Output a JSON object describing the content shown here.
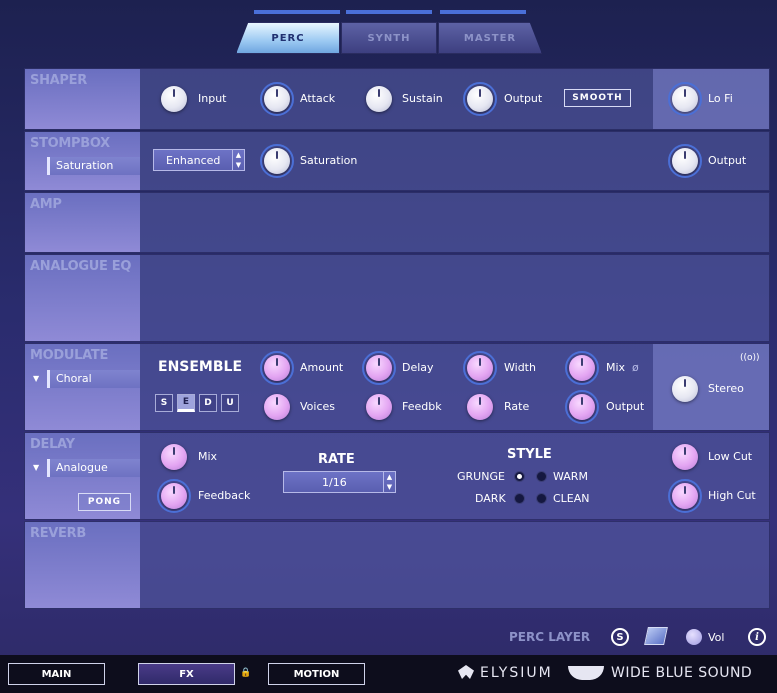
{
  "tabs": [
    {
      "label": "PERC",
      "active": true
    },
    {
      "label": "SYNTH",
      "active": false
    },
    {
      "label": "MASTER",
      "active": false
    }
  ],
  "shaper": {
    "title": "SHAPER",
    "input_label": "Input",
    "attack_label": "Attack",
    "sustain_label": "Sustain",
    "output_label": "Output",
    "smooth_label": "SMOOTH",
    "lofi_label": "Lo Fi"
  },
  "stompbox": {
    "title": "STOMPBOX",
    "type_value": "Saturation",
    "mode_value": "Enhanced",
    "saturation_label": "Saturation",
    "output_label": "Output"
  },
  "amp": {
    "title": "AMP"
  },
  "analogue_eq": {
    "title": "ANALOGUE EQ"
  },
  "modulate": {
    "title": "MODULATE",
    "type_value": "Choral",
    "section_title": "ENSEMBLE",
    "modes": [
      "S",
      "E",
      "D",
      "U"
    ],
    "active_mode": "E",
    "amount_label": "Amount",
    "delay_label": "Delay",
    "width_label": "Width",
    "mix_label": "Mix",
    "phase_symbol": "ø",
    "voices_label": "Voices",
    "feedbk_label": "Feedbk",
    "rate_label": "Rate",
    "output_label": "Output",
    "stereo_icon": "((o))",
    "stereo_label": "Stereo"
  },
  "delay": {
    "title": "DELAY",
    "type_value": "Analogue",
    "pong_label": "PONG",
    "mix_label": "Mix",
    "feedback_label": "Feedback",
    "rate_title": "RATE",
    "rate_value": "1/16",
    "style_title": "STYLE",
    "grunge_label": "GRUNGE",
    "warm_label": "WARM",
    "dark_label": "DARK",
    "clean_label": "CLEAN",
    "lowcut_label": "Low Cut",
    "highcut_label": "High Cut"
  },
  "reverb": {
    "title": "REVERB"
  },
  "layer": {
    "label": "PERC LAYER",
    "solo_label": "S",
    "vol_label": "Vol",
    "info_label": "i"
  },
  "bottom_nav": {
    "main_label": "MAIN",
    "fx_label": "FX",
    "motion_label": "MOTION",
    "lock_icon": "🔒"
  },
  "brand": {
    "product": "ELYSIUM",
    "company": "WIDE BLUE SOUND"
  },
  "colors": {
    "accent_blue": "#4b6fd6",
    "knob_pink": "#e3a5f2",
    "tab_active": "#9cc9f2"
  }
}
